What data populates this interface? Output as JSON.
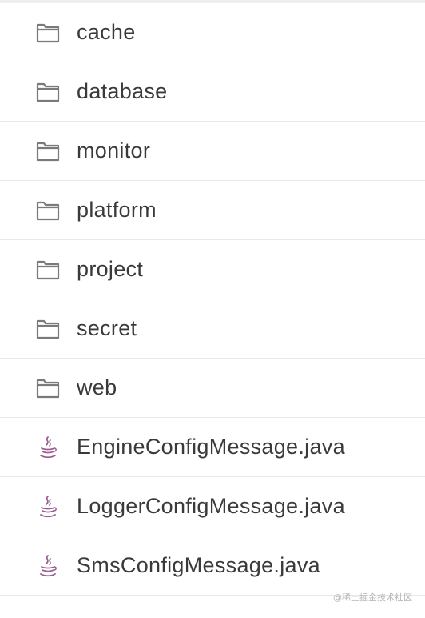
{
  "items": [
    {
      "type": "folder",
      "name": "cache",
      "icon": "folder-icon"
    },
    {
      "type": "folder",
      "name": "database",
      "icon": "folder-icon"
    },
    {
      "type": "folder",
      "name": "monitor",
      "icon": "folder-icon"
    },
    {
      "type": "folder",
      "name": "platform",
      "icon": "folder-icon"
    },
    {
      "type": "folder",
      "name": "project",
      "icon": "folder-icon"
    },
    {
      "type": "folder",
      "name": "secret",
      "icon": "folder-icon"
    },
    {
      "type": "folder",
      "name": "web",
      "icon": "folder-icon"
    },
    {
      "type": "java",
      "name": "EngineConfigMessage.java",
      "icon": "java-file-icon"
    },
    {
      "type": "java",
      "name": "LoggerConfigMessage.java",
      "icon": "java-file-icon"
    },
    {
      "type": "java",
      "name": "SmsConfigMessage.java",
      "icon": "java-file-icon"
    }
  ],
  "colors": {
    "folder_icon": "#7a7a7a",
    "java_icon": "#9b5e93",
    "text": "#3a3a3a",
    "divider": "#e9e9e9"
  },
  "watermark": "@稀土掘金技术社区"
}
